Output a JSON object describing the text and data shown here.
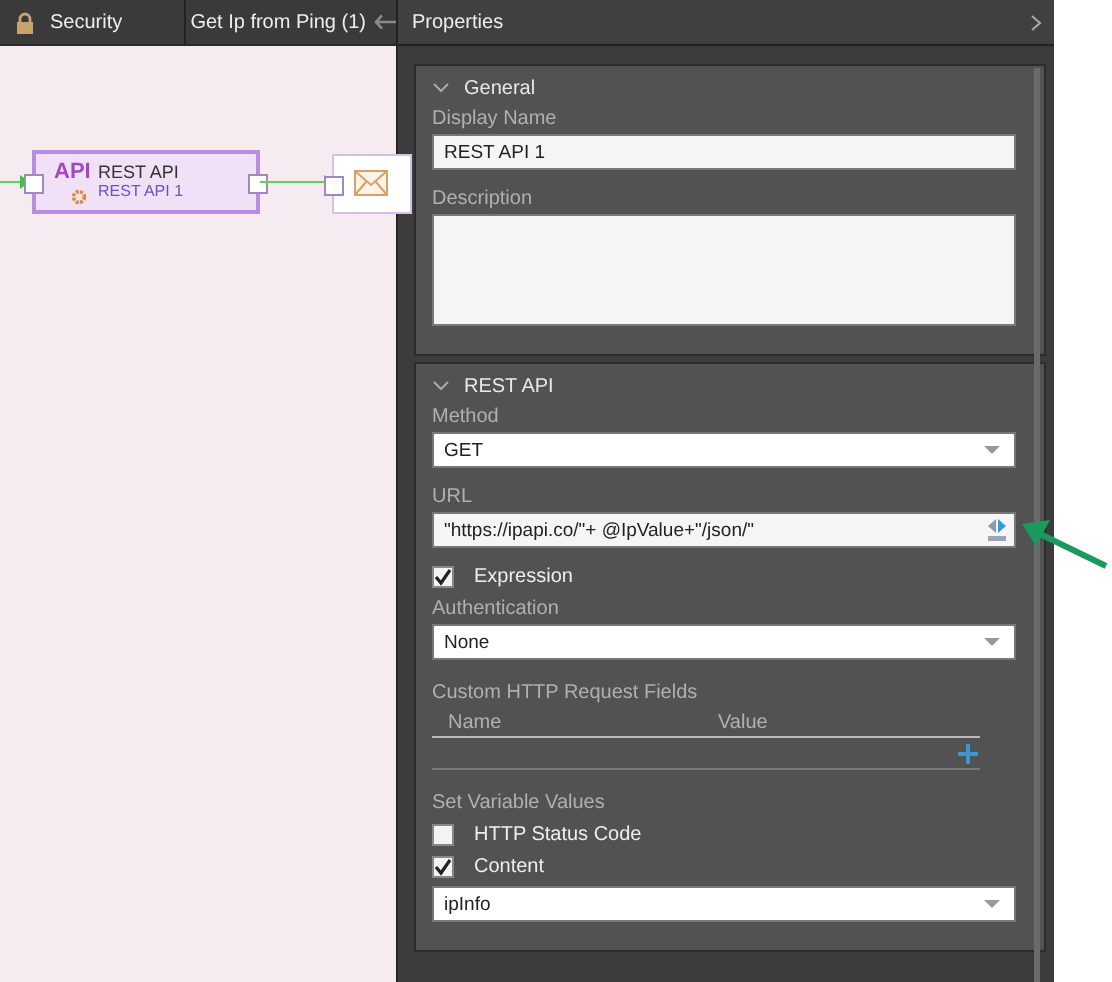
{
  "tabs": [
    {
      "label": "Security",
      "kind": "lock"
    },
    {
      "label": "Get Ip from Ping (1)",
      "kind": "back"
    }
  ],
  "canvas": {
    "nodes": [
      {
        "kind": "api",
        "badge": "API",
        "title": "REST API",
        "subtitle": "REST API 1"
      },
      {
        "kind": "mail"
      }
    ]
  },
  "properties": {
    "title": "Properties",
    "sections": [
      {
        "title": "General",
        "expanded": true,
        "fields": [
          {
            "kind": "text",
            "label": "Display Name",
            "value": "REST API 1"
          },
          {
            "kind": "textarea",
            "label": "Description"
          }
        ]
      },
      {
        "title": "REST API",
        "expanded": true,
        "fields": [
          {
            "kind": "select",
            "label": "Method",
            "value": "GET"
          },
          {
            "kind": "text",
            "label": "URL",
            "value": "\"https://ipapi.co/\"+ @IpValue+\"/json/\"",
            "expression_button": true
          },
          {
            "kind": "checkbox",
            "label": "Expression",
            "checked": true
          },
          {
            "kind": "select",
            "label": "Authentication",
            "value": "None"
          },
          {
            "kind": "table",
            "label": "Custom HTTP Request Fields",
            "columns": [
              "Name",
              "Value"
            ]
          },
          {
            "kind": "heading",
            "label": "Set Variable Values"
          },
          {
            "kind": "checkbox",
            "label": "HTTP Status Code",
            "checked": false
          },
          {
            "kind": "checkbox",
            "label": "Content",
            "checked": true
          },
          {
            "kind": "select",
            "value": "ipInfo"
          }
        ]
      }
    ]
  }
}
